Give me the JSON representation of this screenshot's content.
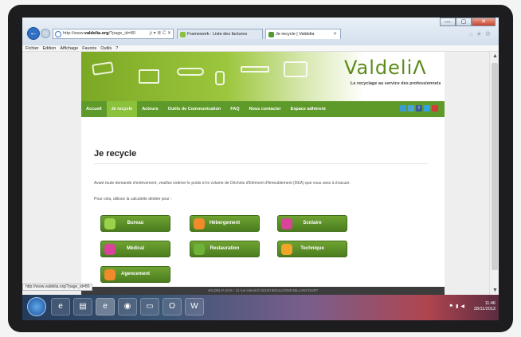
{
  "browser": {
    "address": {
      "prefix": "http://www.",
      "domain": "valdelia.org",
      "path": "/?page_id=80",
      "tools": "ρ ▾ ≣ C ✕"
    },
    "tabs": [
      {
        "label": "Framework : Liste des factures"
      },
      {
        "label": "Je recycle | Valdelia"
      }
    ],
    "menu": [
      "Fichier",
      "Edition",
      "Affichage",
      "Favoris",
      "Outils",
      "?"
    ],
    "window_buttons": [
      "—",
      "▢",
      "✕"
    ],
    "status_url": "http://www.valdelia.org/?page_id=80"
  },
  "site": {
    "logo": "ValdeliΛ",
    "tagline": "Le recyclage au service des professionnels",
    "nav": [
      "Accueil",
      "Je recycle",
      "Acteurs",
      "Outils de Communication",
      "FAQ",
      "Nous contacter",
      "Espace adhérent"
    ],
    "social": [
      "rss-icon",
      "bookmark-icon",
      "facebook-icon",
      "twitter-icon",
      "email-icon"
    ],
    "heading": "Je recycle",
    "intro": "Avant toute demande d'enlèvement, veuillez estimer le poids et le volume de Déchets d'Elément d'Ameublement (DEA) que vous avez à évacuer.",
    "intro2": "Pour cela, utilisez la calculette dédiée pour :",
    "categories": [
      {
        "label": "Bureau"
      },
      {
        "label": "Hébergement"
      },
      {
        "label": "Scolaire"
      },
      {
        "label": "Médical"
      },
      {
        "label": "Restauration"
      },
      {
        "label": "Technique"
      },
      {
        "label": "Agencement"
      }
    ],
    "footer": "VALDELIA SAS - 11 rue Heinrich 92100 BOULOGNE-BILLANCOURT"
  },
  "taskbar": {
    "apps": [
      "ie-icon",
      "explorer-icon",
      "ie-icon",
      "camera-icon",
      "printer-icon",
      "outlook-icon",
      "word-icon"
    ],
    "time": "11:46",
    "date": "28/11/2013"
  },
  "colors": {
    "brand_green": "#5e9a2a",
    "active_green": "#8bc13b",
    "button_green": "#4b7d1f"
  }
}
